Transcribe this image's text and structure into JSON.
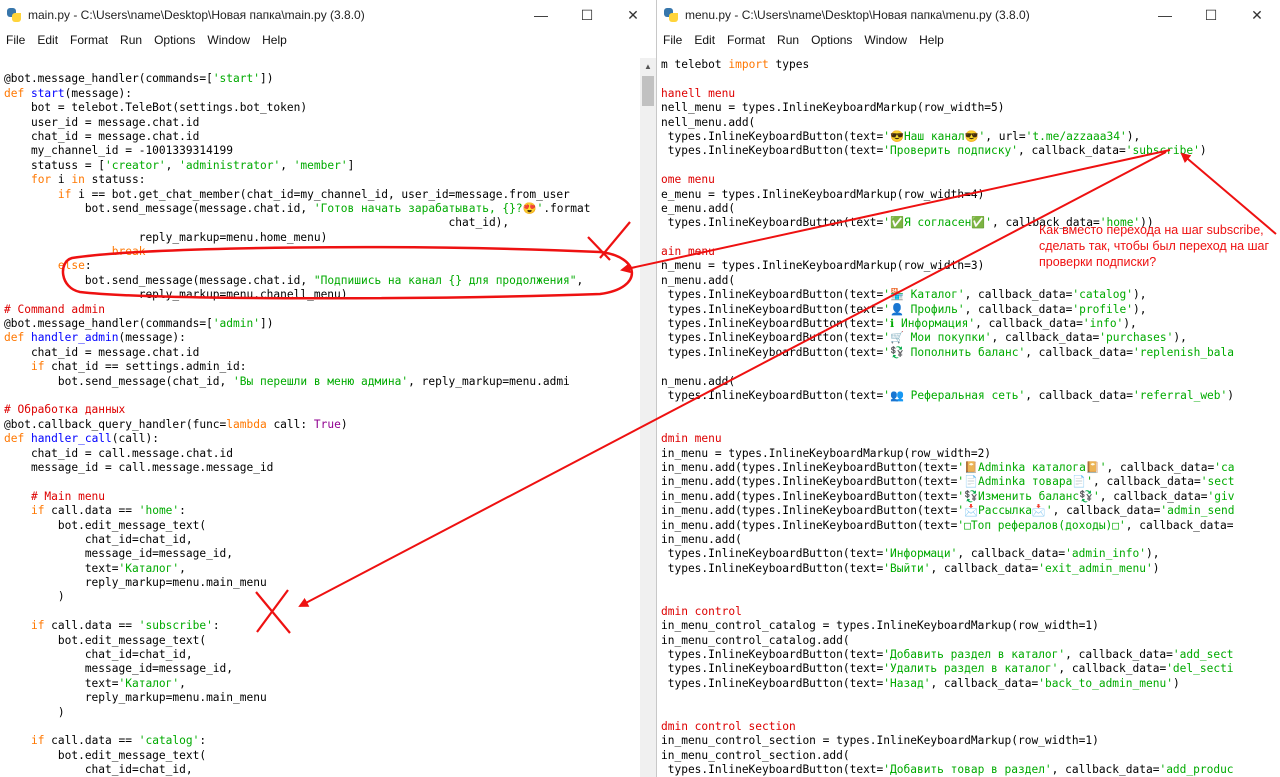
{
  "left_window": {
    "title": "main.py - C:\\Users\\name\\Desktop\\Новая папка\\main.py (3.8.0)",
    "controls": {
      "minimize": "—",
      "maximize": "☐",
      "close": "✕"
    },
    "menu": [
      "File",
      "Edit",
      "Format",
      "Run",
      "Options",
      "Window",
      "Help"
    ],
    "lines": [
      [],
      [
        [
          "@bot.message_handler(commands=[",
          ""
        ],
        [
          "'start'",
          "str"
        ],
        [
          "])",
          ""
        ]
      ],
      [
        [
          "def ",
          "kw"
        ],
        [
          "start",
          "def"
        ],
        [
          "(message):",
          ""
        ]
      ],
      [
        [
          "    bot = telebot.TeleBot(settings.bot_token)",
          ""
        ]
      ],
      [
        [
          "    user_id = message.chat.id",
          ""
        ]
      ],
      [
        [
          "    chat_id = message.chat.id",
          ""
        ]
      ],
      [
        [
          "    my_channel_id = -1001339314199",
          ""
        ]
      ],
      [
        [
          "    statuss = [",
          ""
        ],
        [
          "'creator'",
          "str"
        ],
        [
          ", ",
          ""
        ],
        [
          "'administrator'",
          "str"
        ],
        [
          ", ",
          ""
        ],
        [
          "'member'",
          "str"
        ],
        [
          "]",
          ""
        ]
      ],
      [
        [
          "    ",
          ""
        ],
        [
          "for",
          "kw"
        ],
        [
          " i ",
          ""
        ],
        [
          "in",
          "kw"
        ],
        [
          " statuss:",
          ""
        ]
      ],
      [
        [
          "        ",
          ""
        ],
        [
          "if",
          "kw"
        ],
        [
          " i == bot.get_chat_member(chat_id=my_channel_id, user_id=message.from_user",
          ""
        ]
      ],
      [
        [
          "            bot.send_message(message.chat.id, ",
          ""
        ],
        [
          "'Готов начать зарабатывать, {}?😍'",
          "str"
        ],
        [
          ".format",
          ""
        ]
      ],
      [
        [
          "                                                                  chat_id),",
          ""
        ]
      ],
      [
        [
          "                    reply_markup=menu.home_menu)",
          ""
        ]
      ],
      [
        [
          "                ",
          ""
        ],
        [
          "break",
          "kw"
        ]
      ],
      [
        [
          "        ",
          ""
        ],
        [
          "else",
          "kw"
        ],
        [
          ":",
          ""
        ]
      ],
      [
        [
          "            bot.send_message(message.chat.id, ",
          ""
        ],
        [
          "\"Подпишись на канал {} для продолжения\"",
          "str"
        ],
        [
          ",",
          ""
        ]
      ],
      [
        [
          "                    reply_markup=menu.chanell_menu)",
          ""
        ]
      ],
      [
        [
          "# Command admin",
          "cmt"
        ]
      ],
      [
        [
          "@bot.message_handler(commands=[",
          ""
        ],
        [
          "'admin'",
          "str"
        ],
        [
          "])",
          ""
        ]
      ],
      [
        [
          "def ",
          "kw"
        ],
        [
          "handler_admin",
          "def"
        ],
        [
          "(message):",
          ""
        ]
      ],
      [
        [
          "    chat_id = message.chat.id",
          ""
        ]
      ],
      [
        [
          "    ",
          ""
        ],
        [
          "if",
          "kw"
        ],
        [
          " chat_id == settings.admin_id:",
          ""
        ]
      ],
      [
        [
          "        bot.send_message(chat_id, ",
          ""
        ],
        [
          "'Вы перешли в меню админа'",
          "str"
        ],
        [
          ", reply_markup=menu.admi",
          ""
        ]
      ],
      [],
      [
        [
          "# Обработка данных",
          "cmt"
        ]
      ],
      [
        [
          "@bot.callback_query_handler(func=",
          ""
        ],
        [
          "lambda",
          "kw"
        ],
        [
          " call: ",
          ""
        ],
        [
          "True",
          "bi"
        ],
        [
          ")",
          ""
        ]
      ],
      [
        [
          "def ",
          "kw"
        ],
        [
          "handler_call",
          "def"
        ],
        [
          "(call):",
          ""
        ]
      ],
      [
        [
          "    chat_id = call.message.chat.id",
          ""
        ]
      ],
      [
        [
          "    message_id = call.message.message_id",
          ""
        ]
      ],
      [],
      [
        [
          "    # Main menu",
          "cmt"
        ]
      ],
      [
        [
          "    ",
          ""
        ],
        [
          "if",
          "kw"
        ],
        [
          " call.data == ",
          ""
        ],
        [
          "'home'",
          "str"
        ],
        [
          ":",
          ""
        ]
      ],
      [
        [
          "        bot.edit_message_text(",
          ""
        ]
      ],
      [
        [
          "            chat_id=chat_id,",
          ""
        ]
      ],
      [
        [
          "            message_id=message_id,",
          ""
        ]
      ],
      [
        [
          "            text=",
          ""
        ],
        [
          "'Каталог'",
          "str"
        ],
        [
          ",",
          ""
        ]
      ],
      [
        [
          "            reply_markup=menu.main_menu",
          ""
        ]
      ],
      [
        [
          "        )",
          ""
        ]
      ],
      [],
      [
        [
          "    ",
          ""
        ],
        [
          "if",
          "kw"
        ],
        [
          " call.data == ",
          ""
        ],
        [
          "'subscribe'",
          "str"
        ],
        [
          ":",
          ""
        ]
      ],
      [
        [
          "        bot.edit_message_text(",
          ""
        ]
      ],
      [
        [
          "            chat_id=chat_id,",
          ""
        ]
      ],
      [
        [
          "            message_id=message_id,",
          ""
        ]
      ],
      [
        [
          "            text=",
          ""
        ],
        [
          "'Каталог'",
          "str"
        ],
        [
          ",",
          ""
        ]
      ],
      [
        [
          "            reply_markup=menu.main_menu",
          ""
        ]
      ],
      [
        [
          "        )",
          ""
        ]
      ],
      [],
      [
        [
          "    ",
          ""
        ],
        [
          "if",
          "kw"
        ],
        [
          " call.data == ",
          ""
        ],
        [
          "'catalog'",
          "str"
        ],
        [
          ":",
          ""
        ]
      ],
      [
        [
          "        bot.edit_message_text(",
          ""
        ]
      ],
      [
        [
          "            chat_id=chat_id,",
          ""
        ]
      ]
    ]
  },
  "right_window": {
    "title": "menu.py - C:\\Users\\name\\Desktop\\Новая папка\\menu.py (3.8.0)",
    "controls": {
      "minimize": "—",
      "maximize": "☐",
      "close": "✕"
    },
    "menu": [
      "File",
      "Edit",
      "Format",
      "Run",
      "Options",
      "Window",
      "Help"
    ],
    "lines": [
      [
        [
          "m telebot ",
          ""
        ],
        [
          "import",
          "kw"
        ],
        [
          " types",
          ""
        ]
      ],
      [],
      [
        [
          "hanell menu",
          "cmt"
        ]
      ],
      [
        [
          "nell_menu = types.InlineKeyboardMarkup(row_width=5)",
          ""
        ]
      ],
      [
        [
          "nell_menu.add(",
          ""
        ]
      ],
      [
        [
          " types.InlineKeyboardButton(text=",
          ""
        ],
        [
          "'😎Наш канал😎'",
          "str"
        ],
        [
          ", url=",
          ""
        ],
        [
          "'t.me/azzaaa34'",
          "str"
        ],
        [
          "),",
          ""
        ]
      ],
      [
        [
          " types.InlineKeyboardButton(text=",
          ""
        ],
        [
          "'Проверить подписку'",
          "str"
        ],
        [
          ", callback_data=",
          ""
        ],
        [
          "'subscribe'",
          "str"
        ],
        [
          ")",
          ""
        ]
      ],
      [],
      [
        [
          "ome menu",
          "cmt"
        ]
      ],
      [
        [
          "e_menu = types.InlineKeyboardMarkup(row_width=4)",
          ""
        ]
      ],
      [
        [
          "e_menu.add(",
          ""
        ]
      ],
      [
        [
          " types.InlineKeyboardButton(text=",
          ""
        ],
        [
          "'✅Я согласен✅'",
          "str"
        ],
        [
          ", callback_data=",
          ""
        ],
        [
          "'home'",
          "str"
        ],
        [
          "))",
          ""
        ]
      ],
      [],
      [
        [
          "ain menu",
          "cmt"
        ]
      ],
      [
        [
          "n_menu = types.InlineKeyboardMarkup(row_width=3)",
          ""
        ]
      ],
      [
        [
          "n_menu.add(",
          ""
        ]
      ],
      [
        [
          " types.InlineKeyboardButton(text=",
          ""
        ],
        [
          "'🏪 Каталог'",
          "str"
        ],
        [
          ", callback_data=",
          ""
        ],
        [
          "'catalog'",
          "str"
        ],
        [
          "),",
          ""
        ]
      ],
      [
        [
          " types.InlineKeyboardButton(text=",
          ""
        ],
        [
          "'👤 Профиль'",
          "str"
        ],
        [
          ", callback_data=",
          ""
        ],
        [
          "'profile'",
          "str"
        ],
        [
          "),",
          ""
        ]
      ],
      [
        [
          " types.InlineKeyboardButton(text=",
          ""
        ],
        [
          "'ℹ Информация'",
          "str"
        ],
        [
          ", callback_data=",
          ""
        ],
        [
          "'info'",
          "str"
        ],
        [
          "),",
          ""
        ]
      ],
      [
        [
          " types.InlineKeyboardButton(text=",
          ""
        ],
        [
          "'🛒 Мои покупки'",
          "str"
        ],
        [
          ", callback_data=",
          ""
        ],
        [
          "'purchases'",
          "str"
        ],
        [
          "),",
          ""
        ]
      ],
      [
        [
          " types.InlineKeyboardButton(text=",
          ""
        ],
        [
          "'💱 Пополнить баланс'",
          "str"
        ],
        [
          ", callback_data=",
          ""
        ],
        [
          "'replenish_bala",
          "str"
        ]
      ],
      [],
      [
        [
          "n_menu.add(",
          ""
        ]
      ],
      [
        [
          " types.InlineKeyboardButton(text=",
          ""
        ],
        [
          "'👥 Реферальная сеть'",
          "str"
        ],
        [
          ", callback_data=",
          ""
        ],
        [
          "'referral_web'",
          "str"
        ],
        [
          ")",
          ""
        ]
      ],
      [],
      [],
      [
        [
          "dmin menu",
          "cmt"
        ]
      ],
      [
        [
          "in_menu = types.InlineKeyboardMarkup(row_width=2)",
          ""
        ]
      ],
      [
        [
          "in_menu.add(types.InlineKeyboardButton(text=",
          ""
        ],
        [
          "'📔Adminka каталога📔'",
          "str"
        ],
        [
          ", callback_data=",
          ""
        ],
        [
          "'ca",
          "str"
        ]
      ],
      [
        [
          "in_menu.add(types.InlineKeyboardButton(text=",
          ""
        ],
        [
          "'📄Adminka товара📄'",
          "str"
        ],
        [
          ", callback_data=",
          ""
        ],
        [
          "'sect",
          "str"
        ]
      ],
      [
        [
          "in_menu.add(types.InlineKeyboardButton(text=",
          ""
        ],
        [
          "'💱Изменить баланс💱'",
          "str"
        ],
        [
          ", callback_data=",
          ""
        ],
        [
          "'giv",
          "str"
        ]
      ],
      [
        [
          "in_menu.add(types.InlineKeyboardButton(text=",
          ""
        ],
        [
          "'📩Рассылка📩'",
          "str"
        ],
        [
          ", callback_data=",
          ""
        ],
        [
          "'admin_send",
          "str"
        ]
      ],
      [
        [
          "in_menu.add(types.InlineKeyboardButton(text=",
          ""
        ],
        [
          "'□Топ рефералов(доходы)□'",
          "str"
        ],
        [
          ", callback_data=",
          ""
        ]
      ],
      [
        [
          "in_menu.add(",
          ""
        ]
      ],
      [
        [
          " types.InlineKeyboardButton(text=",
          ""
        ],
        [
          "'Информаци'",
          "str"
        ],
        [
          ", callback_data=",
          ""
        ],
        [
          "'admin_info'",
          "str"
        ],
        [
          "),",
          ""
        ]
      ],
      [
        [
          " types.InlineKeyboardButton(text=",
          ""
        ],
        [
          "'Выйти'",
          "str"
        ],
        [
          ", callback_data=",
          ""
        ],
        [
          "'exit_admin_menu'",
          "str"
        ],
        [
          ")",
          ""
        ]
      ],
      [],
      [],
      [
        [
          "dmin control",
          "cmt"
        ]
      ],
      [
        [
          "in_menu_control_catalog = types.InlineKeyboardMarkup(row_width=1)",
          ""
        ]
      ],
      [
        [
          "in_menu_control_catalog.add(",
          ""
        ]
      ],
      [
        [
          " types.InlineKeyboardButton(text=",
          ""
        ],
        [
          "'Добавить раздел в каталог'",
          "str"
        ],
        [
          ", callback_data=",
          ""
        ],
        [
          "'add_sect",
          "str"
        ]
      ],
      [
        [
          " types.InlineKeyboardButton(text=",
          ""
        ],
        [
          "'Удалить раздел в каталог'",
          "str"
        ],
        [
          ", callback_data=",
          ""
        ],
        [
          "'del_secti",
          "str"
        ]
      ],
      [
        [
          " types.InlineKeyboardButton(text=",
          ""
        ],
        [
          "'Назад'",
          "str"
        ],
        [
          ", callback_data=",
          ""
        ],
        [
          "'back_to_admin_menu'",
          "str"
        ],
        [
          ")",
          ""
        ]
      ],
      [],
      [],
      [
        [
          "dmin control section",
          "cmt"
        ]
      ],
      [
        [
          "in_menu_control_section = types.InlineKeyboardMarkup(row_width=1)",
          ""
        ]
      ],
      [
        [
          "in_menu_control_section.add(",
          ""
        ]
      ],
      [
        [
          " types.InlineKeyboardButton(text=",
          ""
        ],
        [
          "'Добавить товар в раздел'",
          "str"
        ],
        [
          ", callback_data=",
          ""
        ],
        [
          "'add_produc",
          "str"
        ]
      ]
    ]
  },
  "annotation": {
    "question": "Как вместо перехода на шаг subscribe, сделать так, чтобы был переход на шаг проверки подписки?",
    "color": "#ee1111"
  },
  "colors": {
    "keyword": "#ff7700",
    "string": "#00aa00",
    "comment": "#dd0000",
    "definition": "#0000ff",
    "builtin": "#900090"
  }
}
